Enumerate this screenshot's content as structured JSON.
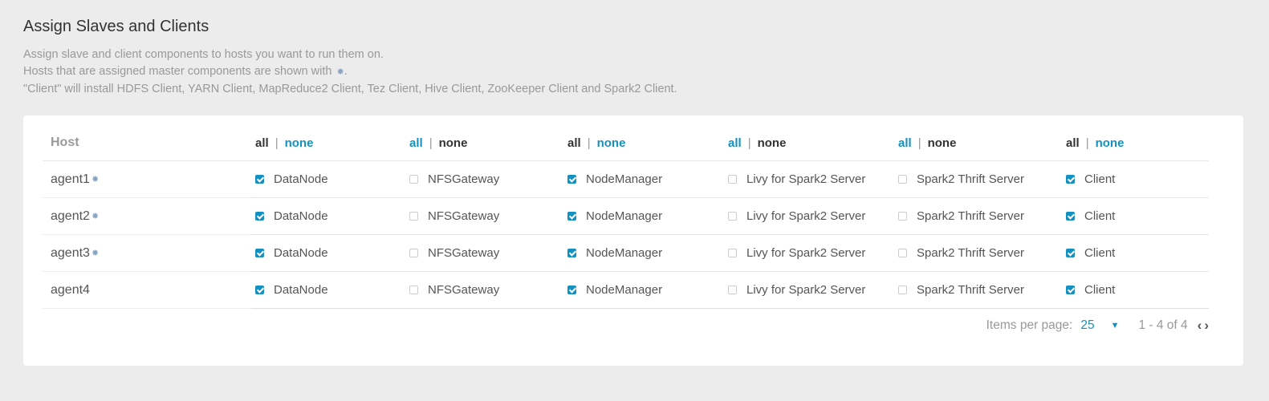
{
  "page": {
    "title": "Assign Slaves and Clients",
    "desc_line1": "Assign slave and client components to hosts you want to run them on.",
    "desc_line2_pre": "Hosts that are assigned master components are shown with",
    "desc_line2_post": ".",
    "desc_line3": "\"Client\" will install HDFS Client, YARN Client, MapReduce2 Client, Tez Client, Hive Client, ZooKeeper Client and Spark2 Client."
  },
  "table": {
    "host_header": "Host",
    "toggle_all": "all",
    "toggle_none": "none",
    "toggle_sep": "|",
    "master_icon": "✸",
    "columns": [
      {
        "label": "DataNode",
        "active": "all"
      },
      {
        "label": "NFSGateway",
        "active": "none"
      },
      {
        "label": "NodeManager",
        "active": "all"
      },
      {
        "label": "Livy for Spark2 Server",
        "active": "none"
      },
      {
        "label": "Spark2 Thrift Server",
        "active": "none"
      },
      {
        "label": "Client",
        "active": "all"
      }
    ],
    "rows": [
      {
        "host": "agent1",
        "master": true,
        "checks": [
          true,
          false,
          true,
          false,
          false,
          true
        ]
      },
      {
        "host": "agent2",
        "master": true,
        "checks": [
          true,
          false,
          true,
          false,
          false,
          true
        ]
      },
      {
        "host": "agent3",
        "master": true,
        "checks": [
          true,
          false,
          true,
          false,
          false,
          true
        ]
      },
      {
        "host": "agent4",
        "master": false,
        "checks": [
          true,
          false,
          true,
          false,
          false,
          true
        ]
      }
    ]
  },
  "pager": {
    "items_label": "Items per page:",
    "per_page": "25",
    "caret": "▼",
    "range": "1 - 4 of 4",
    "prev": "‹",
    "next": "›"
  }
}
